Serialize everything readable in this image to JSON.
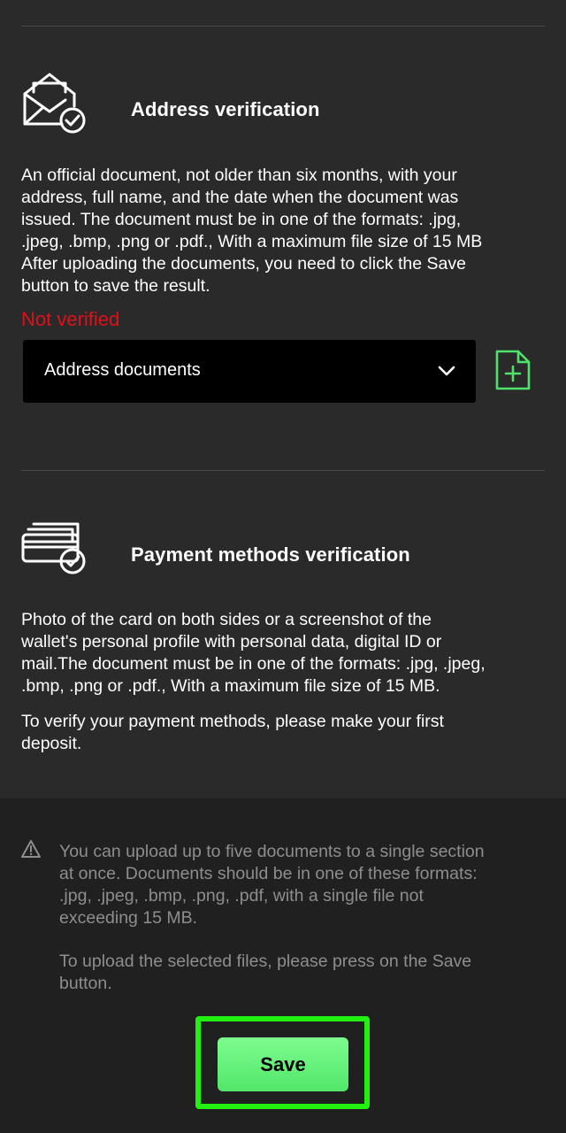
{
  "colors": {
    "background": "#2a2a2a",
    "panel": "#202020",
    "select_bg": "#000000",
    "error": "#e0101a",
    "accent": "#4ee36a",
    "highlight": "#22f010",
    "muted_text": "#8e8e8e"
  },
  "address_section": {
    "icon": "envelope-check-icon",
    "title": "Address verification",
    "description_lines": [
      "An official document, not older than six months, with your",
      "address, full name, and the date when the document was",
      "issued. The document must be in one of the formats: .jpg,",
      ".jpeg, .bmp, .png or .pdf., With a maximum file size of 15 MB",
      "After uploading the documents, you need to click the Save",
      "button to save the result."
    ],
    "status": "Not verified",
    "select_value": "Address documents",
    "chevron_icon": "chevron-down-icon",
    "upload_icon": "add-file-icon"
  },
  "payment_section": {
    "icon": "cards-check-icon",
    "title": "Payment methods verification",
    "description_lines": [
      "Photo of the card on both sides or a screenshot of the",
      "wallet's personal profile with personal data, digital ID or",
      "mail.The document must be in one of the formats: .jpg, .jpeg,",
      ".bmp, .png or .pdf., With a maximum file size of 15 MB."
    ],
    "deposit_note_lines": [
      "To verify your payment methods, please make your first",
      "deposit."
    ]
  },
  "notice": {
    "icon": "warning-icon",
    "lines": [
      "You can upload up to five documents to a single section",
      "at once. Documents should be in one of these formats:",
      ".jpg, .jpeg, .bmp, .png, .pdf, with a single file not",
      "exceeding 15 MB."
    ],
    "save_hint_lines": [
      "To upload the selected files, please press on the Save",
      "button."
    ]
  },
  "save_button_label": "Save"
}
